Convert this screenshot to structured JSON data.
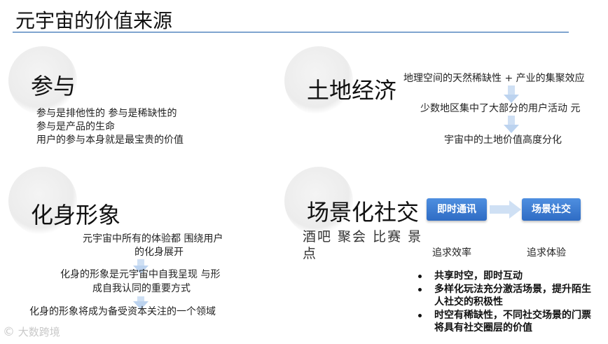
{
  "title": "元宇宙的价值来源",
  "participation": {
    "heading": "参与",
    "lines": [
      "参与是排他性的 参与是稀缺性的",
      "参与是产品的生命",
      "用户的参与本身就是最宝贵的价值"
    ]
  },
  "land_economy": {
    "heading": "土地经济",
    "steps": [
      "地理空间的天然稀缺性 + 产业的集聚效应",
      "少数地区集中了大部分的用户活动 元",
      "宇宙中的土地价值高度分化"
    ]
  },
  "avatar": {
    "heading": "化身形象",
    "p1": [
      "元宇宙中所有的体验都 围绕用户",
      "的化身展开"
    ],
    "p2": [
      "化身的形象是元宇宙中自我呈现 与形",
      "成自我认同的重要方式"
    ],
    "p3": "化身的形象将成为备受资本关注的一个领域"
  },
  "social_scene": {
    "heading": "场景化社交",
    "scenes": [
      "酒吧 聚会 比赛 景",
      "点"
    ],
    "box1": "即时通讯",
    "box2": "场景社交",
    "caption1": "追求效率",
    "caption2": "追求体验",
    "bullets": [
      "共享时空，即时互动",
      "多样化玩法充分激活场景，提升陌生人社交的积极性",
      "时空有稀缺性，不同社交场景的门票将具有社交圈层的价值"
    ]
  },
  "watermark": "大数跨境"
}
